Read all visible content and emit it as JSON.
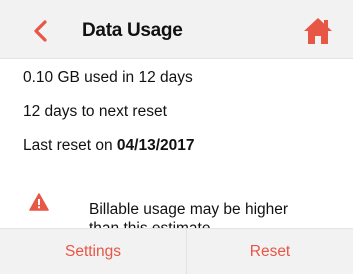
{
  "header": {
    "title": "Data Usage",
    "back_icon": "chevron-left-icon",
    "home_icon": "home-icon"
  },
  "usage": {
    "used_line": "0.10 GB used in 12 days",
    "reset_line": "12 days to next reset",
    "last_reset_prefix": "Last reset on",
    "last_reset_date": "04/13/2017"
  },
  "warning": {
    "icon": "warning-triangle-icon",
    "line1": "Billable usage may be higher",
    "line2": "than this estimate"
  },
  "footer": {
    "settings_label": "Settings",
    "reset_label": "Reset"
  },
  "colors": {
    "accent": "#e85646",
    "header_bg": "#f2f2f2",
    "footer_bg": "#f2f2f2"
  }
}
